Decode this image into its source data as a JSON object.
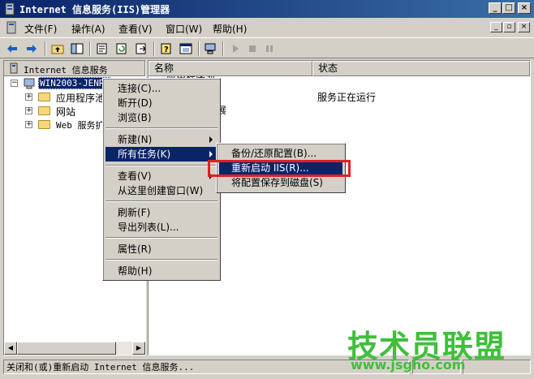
{
  "window": {
    "title": "Internet 信息服务(IIS)管理器",
    "minimize": "_",
    "maximize": "□",
    "close": "×"
  },
  "menubar": {
    "items": [
      "文件(F)",
      "操作(A)",
      "查看(V)",
      "窗口(W)",
      "帮助(H)"
    ]
  },
  "toolbar": {
    "icons": [
      "back-icon",
      "forward-icon",
      "up-folder-icon",
      "show-tree-icon",
      "properties-icon",
      "refresh-icon",
      "export-icon",
      "help-icon",
      "new-window-icon",
      "computer-icon",
      "play-icon",
      "stop-icon",
      "pause-icon"
    ]
  },
  "tree": {
    "header": "Internet 信息服务",
    "root": "WIN2003-JENRY",
    "children": [
      "应用程序池",
      "网站",
      "Web 服务扩"
    ]
  },
  "list": {
    "columns": [
      "名称",
      "状态"
    ],
    "rows": [
      {
        "name": "应用程序池",
        "status": ""
      },
      {
        "name": "展",
        "status": "服务正在运行"
      }
    ]
  },
  "context_menu": {
    "items": [
      {
        "label": "连接(C)...",
        "submenu": false
      },
      {
        "label": "断开(D)",
        "submenu": false
      },
      {
        "label": "浏览(B)",
        "submenu": false
      },
      {
        "label": "新建(N)",
        "submenu": true
      },
      {
        "label": "所有任务(K)",
        "submenu": true,
        "highlighted": true
      },
      {
        "label": "查看(V)",
        "submenu": true
      },
      {
        "label": "从这里创建窗口(W)",
        "submenu": false
      },
      {
        "label": "刷新(F)",
        "submenu": false
      },
      {
        "label": "导出列表(L)...",
        "submenu": false
      },
      {
        "label": "属性(R)",
        "submenu": false
      },
      {
        "label": "帮助(H)",
        "submenu": false
      }
    ]
  },
  "submenu": {
    "items": [
      {
        "label": "备份/还原配置(B)..."
      },
      {
        "label": "重新启动 IIS(R)...",
        "highlighted": true
      },
      {
        "label": "将配置保存到磁盘(S)"
      }
    ]
  },
  "status_bar": {
    "text": "关闭和(或)重新启动 Internet 信息服务..."
  },
  "watermark": {
    "logo": "技术员联盟",
    "url": "www.jsgho.com"
  },
  "colors": {
    "highlight": "#0a246a",
    "callout": "#e02020",
    "watermark": "#3fbf3a"
  }
}
